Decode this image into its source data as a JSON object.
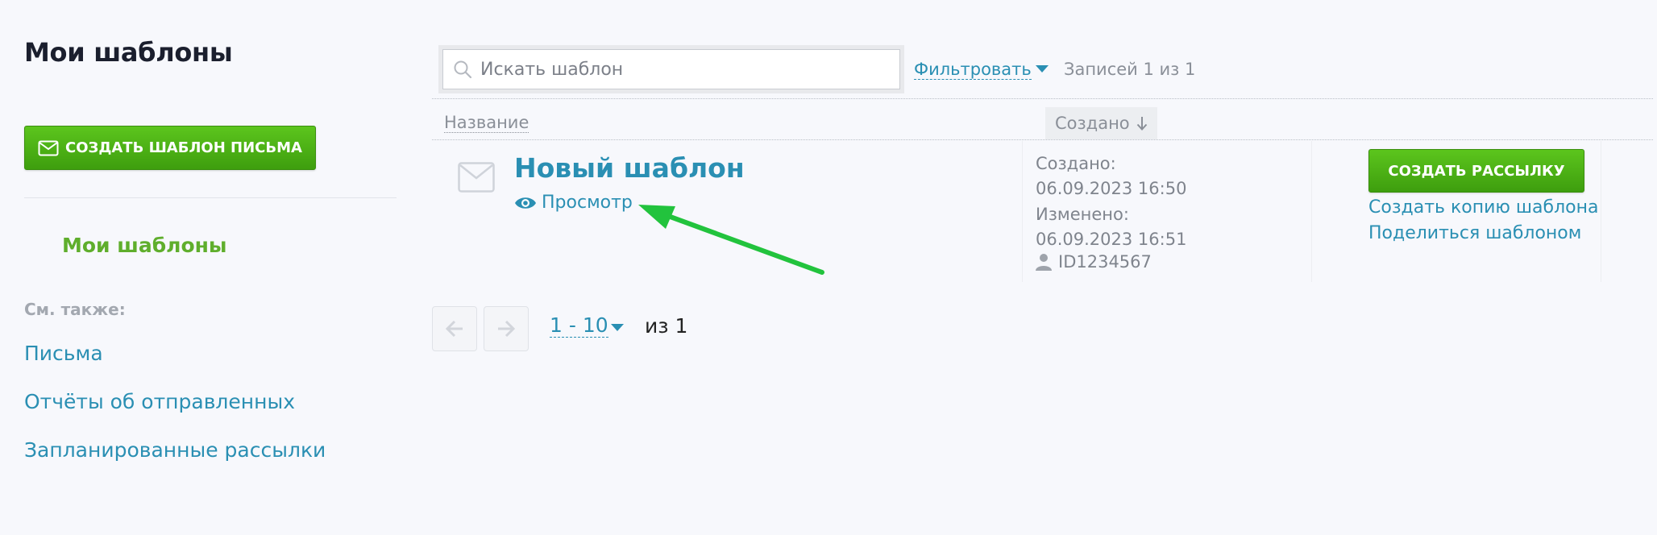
{
  "sidebar": {
    "title": "Мои шаблоны",
    "create_button": "СОЗДАТЬ ШАБЛОН ПИСЬМА",
    "active_item": "Мои шаблоны",
    "see_also": "См. также:",
    "links": [
      "Письма",
      "Отчёты об отправленных",
      "Запланированные рассылки"
    ]
  },
  "toolbar": {
    "search_placeholder": "Искать шаблон",
    "filter": "Фильтровать",
    "records": "Записей 1 из 1"
  },
  "table": {
    "columns": {
      "name": "Название",
      "created": "Создано"
    },
    "rows": [
      {
        "title": "Новый шаблон",
        "preview": "Просмотр",
        "created_label": "Создано:",
        "created_value": "06.09.2023 16:50",
        "modified_label": "Изменено:",
        "modified_value": "06.09.2023 16:51",
        "owner_id": "ID1234567",
        "send_button": "СОЗДАТЬ РАССЫЛКУ",
        "copy_link": "Создать копию шаблона",
        "share_link": "Поделиться шаблоном"
      }
    ]
  },
  "pagination": {
    "range": "1 - 10",
    "of": "из 1"
  },
  "colors": {
    "accent": "#2a8fb3",
    "green": "#4fb317",
    "annotation": "#22c33d"
  }
}
